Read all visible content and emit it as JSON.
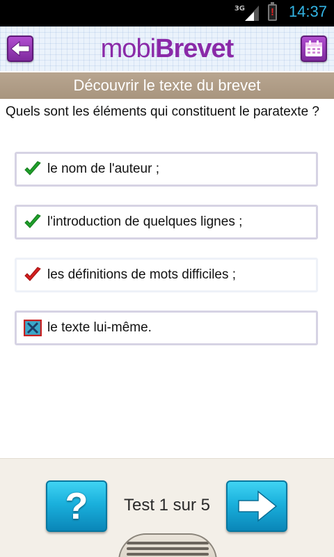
{
  "status_bar": {
    "network": "3G",
    "battery_warning": "!",
    "time": "14:37"
  },
  "header": {
    "logo_part1": "mobi",
    "logo_part2": "Brevet",
    "back_icon": "arrow-left-icon",
    "calendar_icon": "calendar-icon"
  },
  "title": "Découvrir le texte du brevet",
  "question": "Quels sont les éléments qui constituent le paratexte ?",
  "answers": [
    {
      "label": "le nom de l'auteur ;",
      "mark": "check-green"
    },
    {
      "label": "l'introduction de quelques lignes ;",
      "mark": "check-green"
    },
    {
      "label": "les définitions de mots difficiles ;",
      "mark": "check-red"
    },
    {
      "label": "le texte lui-même.",
      "mark": "cross-box"
    }
  ],
  "footer": {
    "help_label": "?",
    "counter": "Test 1 sur 5",
    "next_icon": "arrow-right-icon"
  },
  "colors": {
    "accent_purple": "#8a2aa8",
    "title_bar": "#b09d87",
    "button_blue": "#1ab0dc",
    "clock_blue": "#33b5e5"
  }
}
